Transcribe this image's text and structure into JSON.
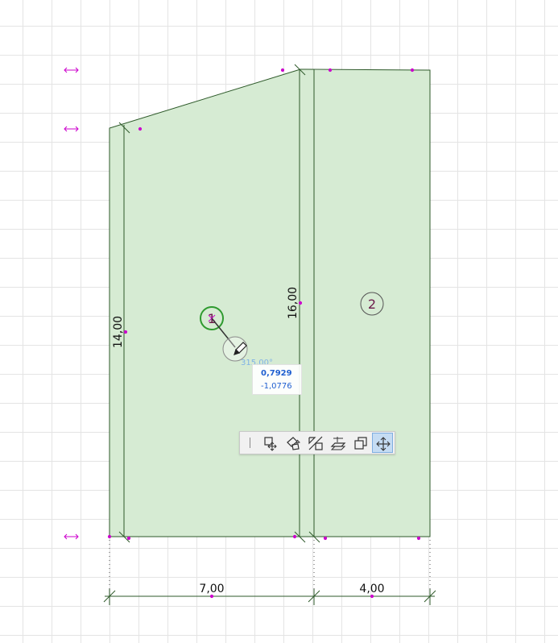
{
  "drawing": {
    "zones": [
      {
        "id": "zone-1",
        "stamp": "1"
      },
      {
        "id": "zone-2",
        "stamp": "2"
      }
    ],
    "dimensions": {
      "height_left": "14,00",
      "height_mid": "16,00",
      "width_left": "7,00",
      "width_right": "4,00"
    },
    "cursor": {
      "angle": "315,00°",
      "coord_x": "0,7929",
      "coord_y": "-1,0776"
    }
  },
  "pet_palette": {
    "tools": [
      {
        "name": "drag-tool",
        "icon": "drag-icon"
      },
      {
        "name": "rotate-tool",
        "icon": "rotate-icon"
      },
      {
        "name": "mirror-tool",
        "icon": "mirror-icon"
      },
      {
        "name": "elevate-tool",
        "icon": "elevate-icon"
      },
      {
        "name": "multiply-tool",
        "icon": "multiply-icon"
      },
      {
        "name": "move-tool",
        "icon": "move-icon",
        "active": true
      }
    ]
  },
  "colors": {
    "zone_fill": "#d6ebd3",
    "outline": "#2e5a2a",
    "hotspot": "#cc00cc",
    "active_tool": "#c5dcf3"
  }
}
